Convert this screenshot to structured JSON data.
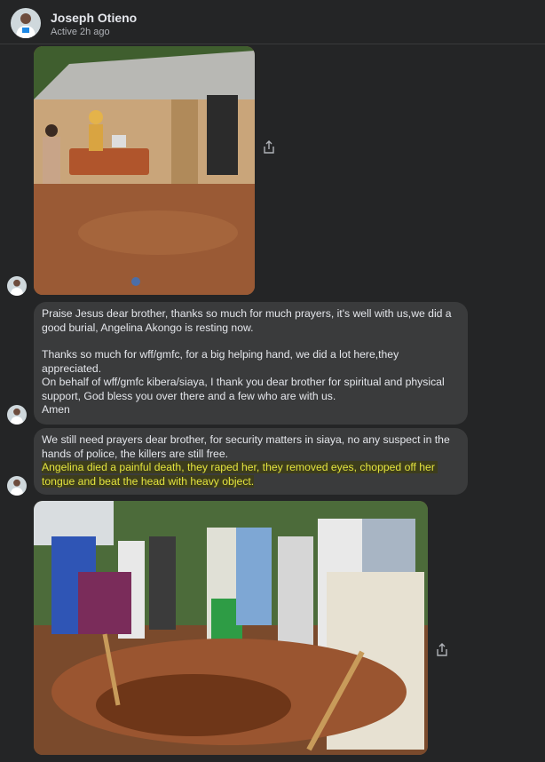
{
  "header": {
    "name": "Joseph Otieno",
    "status": "Active 2h ago",
    "avatar_icon": "user-avatar-icon"
  },
  "messages": [
    {
      "type": "image",
      "icon": "photo-house-coffin",
      "share_icon": "share-icon"
    },
    {
      "type": "text",
      "paragraphs": [
        "Praise Jesus dear brother, thanks so much for much prayers, it's well with us,we did a good burial, Angelina Akongo is resting now.",
        "Thanks so much for wff/gmfc, for a big helping hand, we did a lot here,they appreciated.\nOn behalf of wff/gmfc kibera/siaya, I thank you dear brother for spiritual and physical support, God bless you over there and a few who are with us.\nAmen"
      ]
    },
    {
      "type": "text",
      "plain": "We still need prayers dear brother, for security matters in siaya, no any suspect in the hands of police, the killers are still free.",
      "highlighted": "Angelina died a painful death, they raped her, they removed eyes, chopped off her tongue and beat the head with heavy object."
    },
    {
      "type": "image",
      "icon": "photo-grave-digging",
      "share_icon": "share-icon"
    }
  ],
  "colors": {
    "background": "#242526",
    "bubble": "#3a3b3c",
    "highlight_text": "#e3e33e",
    "highlight_bg": "#3d3d1c"
  }
}
